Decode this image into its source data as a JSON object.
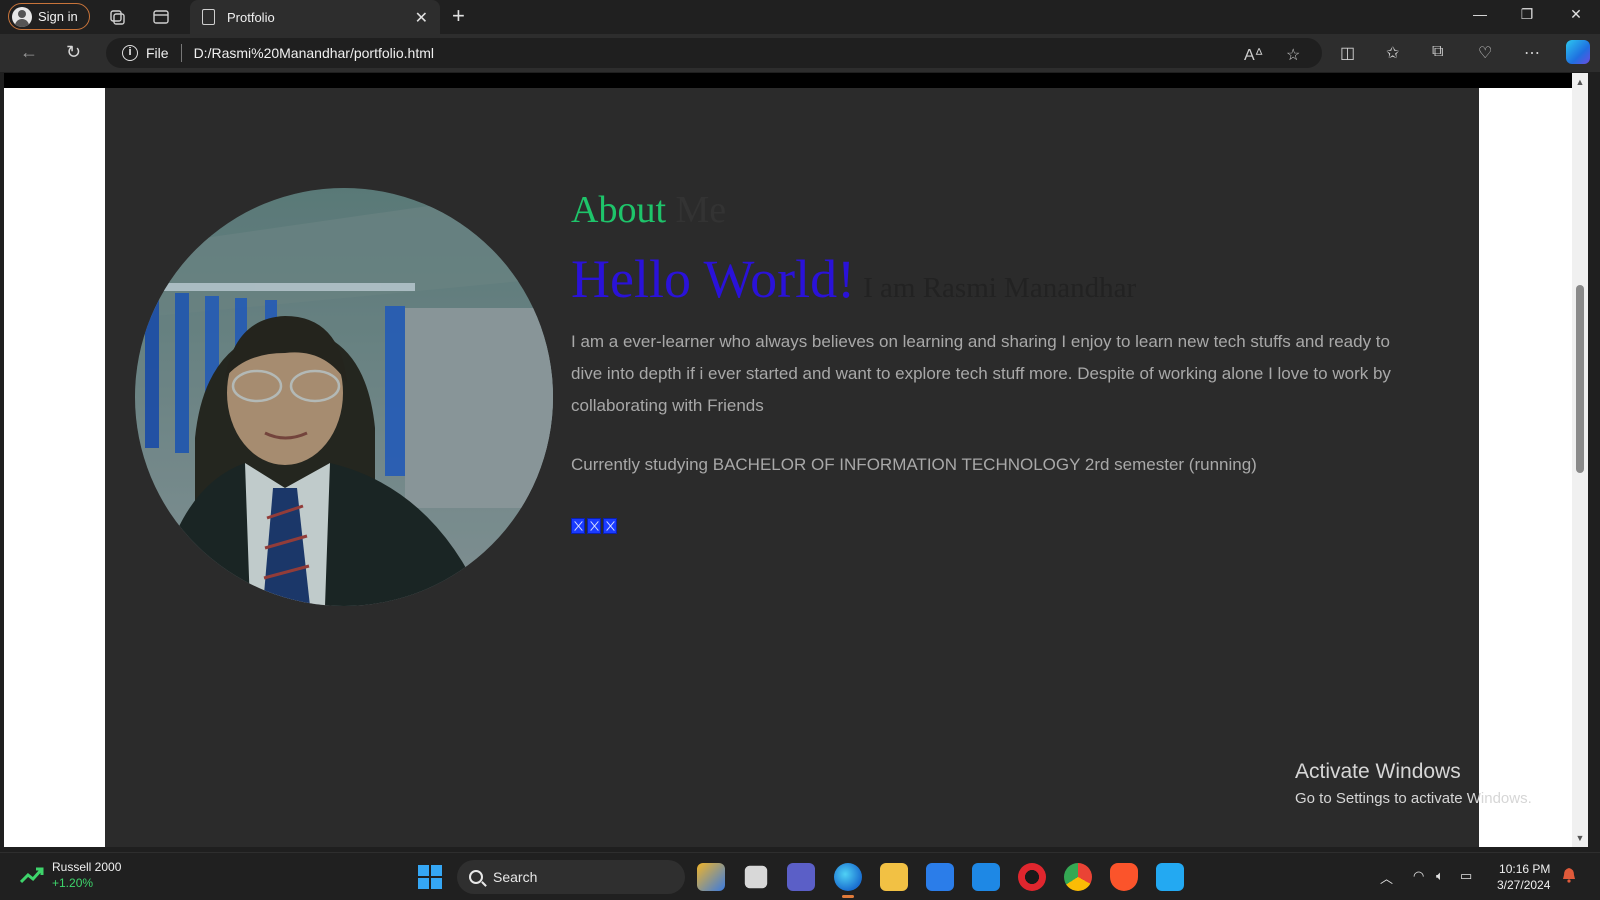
{
  "browser": {
    "signin_label": "Sign in",
    "tab_title": "Protfolio",
    "address_scheme": "File",
    "address_url": "D:/Rasmi%20Manandhar/portfolio.html"
  },
  "page": {
    "about_word": "About",
    "me_word": "Me",
    "hello": "Hello World!",
    "iam": "I am Rasmi Manandhar",
    "bio": "I am a ever-learner who always believes on learning and sharing I enjoy to learn new tech stuffs and ready to dive into depth if i ever started and want to explore tech stuff more. Despite of working alone I love to work by collaborating with Friends",
    "study": "Currently studying BACHELOR OF INFORMATION TECHNOLOGY 2rd semester (running)",
    "accent_green": "#1ec46a",
    "accent_blue": "#2a12d9"
  },
  "watermark": {
    "line1": "Activate Windows",
    "line2": "Go to Settings to activate Windows."
  },
  "taskbar": {
    "widget_name": "Russell 2000",
    "widget_change": "+1.20%",
    "search_label": "Search",
    "time": "10:16 PM",
    "date": "3/27/2024"
  }
}
